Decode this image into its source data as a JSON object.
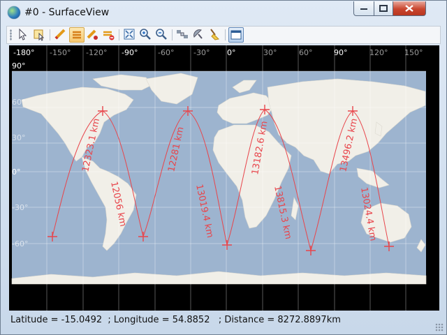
{
  "window": {
    "title": "#0 - SurfaceView"
  },
  "icons": {
    "app": "globe-icon",
    "toolbar": [
      "select-arrow-icon",
      "select-region-icon",
      "measure-line-icon",
      "measure-path-icon",
      "measure-distance-icon",
      "clear-measure-icon",
      "zoom-extent-icon",
      "zoom-in-icon",
      "zoom-out-icon",
      "satellite-icon",
      "antenna-icon",
      "broom-clear-icon",
      "window-layout-icon"
    ]
  },
  "map": {
    "top_ticks": [
      "-180°",
      "-150°",
      "-120°",
      "-90°",
      "-60°",
      "-30°",
      "0°",
      "30°",
      "60°",
      "90°",
      "120°",
      "150°"
    ],
    "left_ticks": [
      "90°",
      "60°",
      "30°",
      "0°",
      "-30°",
      "-60°"
    ],
    "route_labels": [
      "12323.1 km",
      "12056 km",
      "12281 km",
      "13019.4 km",
      "13182.6 km",
      "13815.3 km",
      "13496.2 km",
      "13024.4 km"
    ],
    "colors": {
      "ocean": "#9db4cf",
      "land": "#f1efe8",
      "route": "#e8454b",
      "frame": "#000000"
    }
  },
  "status": {
    "latitude": "Latitude = -15.0492",
    "longitude": "; Longitude = 54.8852",
    "distance": "; Distance = 8272.8897km"
  }
}
